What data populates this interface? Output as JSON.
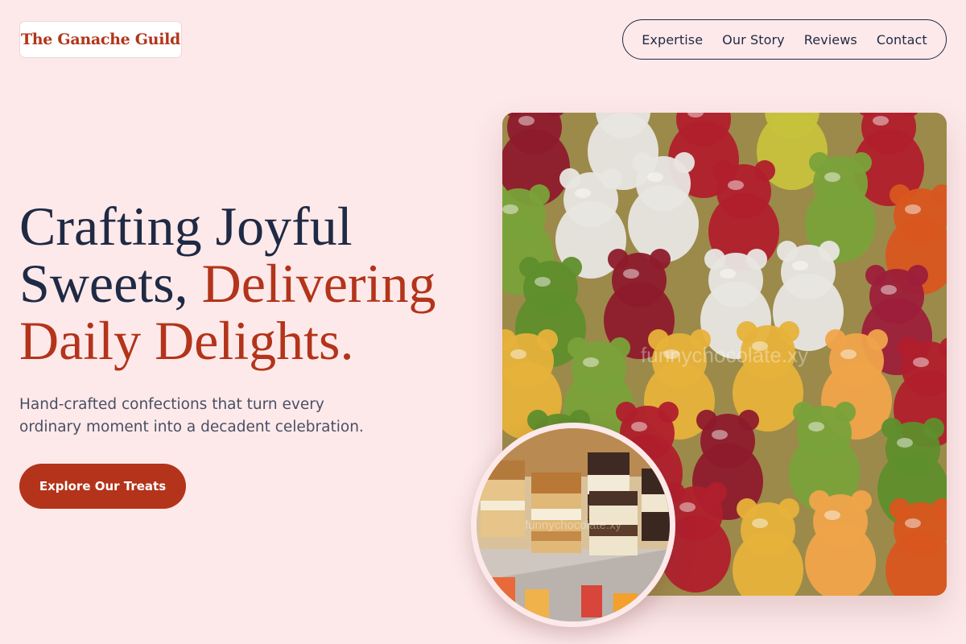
{
  "brand": {
    "name": "The Ganache Guild"
  },
  "nav": {
    "items": [
      {
        "label": "Expertise"
      },
      {
        "label": "Our Story"
      },
      {
        "label": "Reviews"
      },
      {
        "label": "Contact"
      }
    ]
  },
  "hero": {
    "headline_part1": "Crafting Joyful Sweets, ",
    "headline_accent": "Delivering Daily Delights.",
    "subtitle": "Hand-crafted confections that turn every ordinary moment into a decadent celebration.",
    "cta_label": "Explore Our Treats",
    "main_image_watermark": "funnychocolate.xy",
    "inset_image_watermark": "funnychocolate.xy"
  },
  "colors": {
    "background": "#fde9ea",
    "accent": "#b3341a",
    "text": "#1f2a44"
  }
}
